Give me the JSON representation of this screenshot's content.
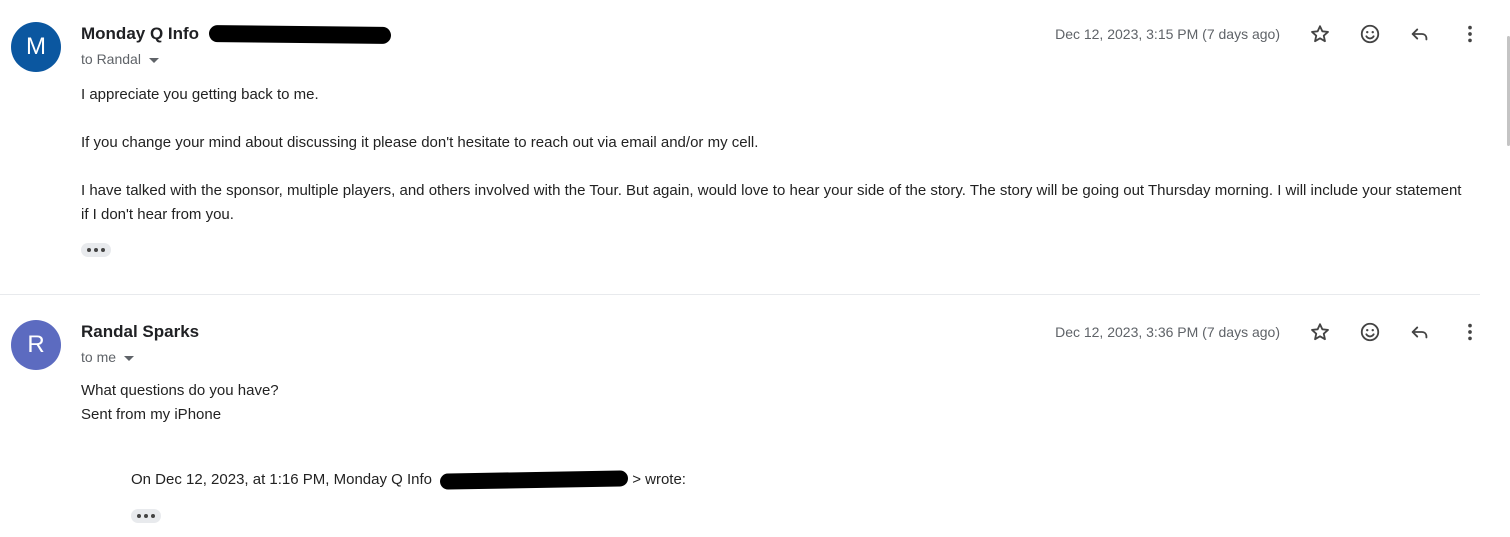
{
  "messages": [
    {
      "avatar_letter": "M",
      "avatar_color": "#0b57a0",
      "sender": "Monday Q Info",
      "recipient": "to Randal",
      "date": "Dec 12, 2023, 3:15 PM (7 days ago)",
      "body": [
        "I appreciate you getting back to me.",
        "If you change your mind about discussing it please don't hesitate to reach out via email and/or my cell.",
        "I have talked with the sponsor, multiple players, and others involved with the Tour. But again, would love to hear your side of the story. The story will be going out Thursday morning. I will include your statement if I don't hear from you."
      ],
      "icons": [
        "star-icon",
        "emoji-icon",
        "reply-icon",
        "more-vert-icon"
      ]
    },
    {
      "avatar_letter": "R",
      "avatar_color": "#5c6bc0",
      "sender": "Randal Sparks",
      "recipient": "to me",
      "date": "Dec 12, 2023, 3:36 PM (7 days ago)",
      "body": [
        "What questions do you have?",
        "Sent from my iPhone"
      ],
      "quote_prefix": "On Dec 12, 2023, at 1:16 PM, Monday Q Info",
      "quote_suffix": "> wrote:",
      "icons": [
        "star-icon",
        "emoji-icon",
        "reply-icon",
        "more-vert-icon"
      ]
    }
  ]
}
